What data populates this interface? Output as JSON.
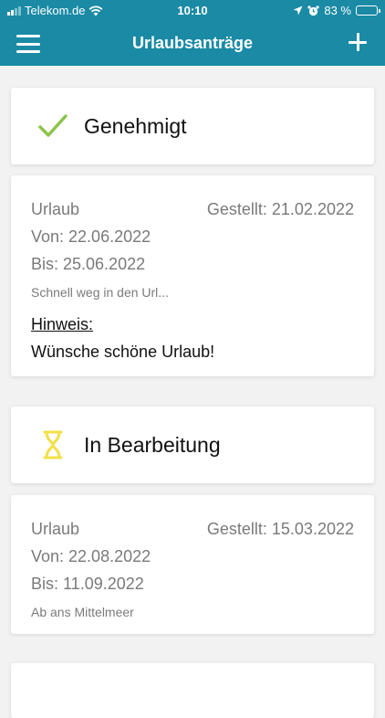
{
  "statusbar": {
    "carrier": "Telekom.de",
    "time": "10:10",
    "battery": "83 %",
    "battery_level": 0.83
  },
  "header": {
    "title": "Urlaubsanträge",
    "menu_icon": "hamburger-icon",
    "add_icon": "plus-icon"
  },
  "colors": {
    "primary": "#1a8aa5",
    "approved": "#8bc34a",
    "pending": "#f3e047"
  },
  "sections": [
    {
      "status": "Genehmigt",
      "icon": "checkmark-icon",
      "request": {
        "type": "Urlaub",
        "submitted": "Gestellt: 21.02.2022",
        "from": "Von: 22.06.2022",
        "to": "Bis: 25.06.2022",
        "note": "Schnell weg in den Url...",
        "hint_label": "Hinweis:",
        "hint_text": "Wünsche schöne Urlaub!"
      }
    },
    {
      "status": "In Bearbeitung",
      "icon": "hourglass-icon",
      "request": {
        "type": "Urlaub",
        "submitted": "Gestellt: 15.03.2022",
        "from": "Von: 22.08.2022",
        "to": "Bis: 11.09.2022",
        "note": "Ab ans Mittelmeer"
      }
    }
  ]
}
